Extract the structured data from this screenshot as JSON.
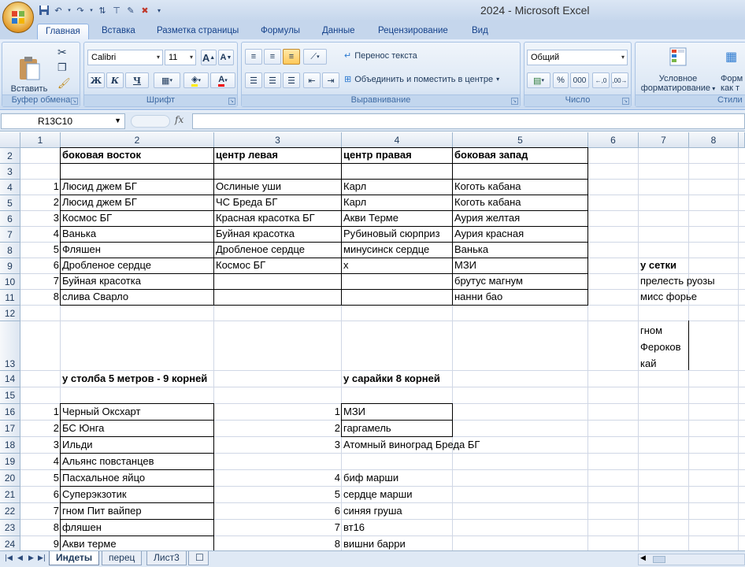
{
  "window": {
    "title": "2024 - Microsoft Excel"
  },
  "tabs": [
    "Главная",
    "Вставка",
    "Разметка страницы",
    "Формулы",
    "Данные",
    "Рецензирование",
    "Вид"
  ],
  "ribbon": {
    "clipboard": {
      "label": "Буфер обмена",
      "paste": "Вставить"
    },
    "font": {
      "label": "Шрифт",
      "name": "Calibri",
      "size": "11",
      "bold": "Ж",
      "italic": "К",
      "underline": "Ч",
      "grow": "A",
      "shrink": "A"
    },
    "alignment": {
      "label": "Выравнивание",
      "wrap": "Перенос текста",
      "merge": "Объединить и поместить в центре"
    },
    "number": {
      "label": "Число",
      "format": "Общий",
      "percent": "%",
      "thousands": "000"
    },
    "styles": {
      "label": "Стили",
      "conditional": "Условное",
      "conditional2": "форматирование",
      "format_as": "Форм",
      "format_as2": "как т"
    }
  },
  "formula_bar": {
    "name_box": "R13C10",
    "fx": "fx",
    "value": ""
  },
  "columns": [
    "1",
    "2",
    "3",
    "4",
    "5",
    "6",
    "7",
    "8"
  ],
  "rows": [
    "2",
    "3",
    "4",
    "5",
    "6",
    "7",
    "8",
    "9",
    "10",
    "11",
    "12",
    "13",
    "14",
    "15",
    "16",
    "17",
    "18",
    "19",
    "20",
    "21",
    "22",
    "23",
    "24"
  ],
  "cells": {
    "r2c2": "боковая восток",
    "r2c3": "центр левая",
    "r2c4": "центр правая",
    "r2c5": "боковая запад",
    "r4c1": "1",
    "r4c2": "Люсид джем БГ",
    "r4c3": "Ослиные уши",
    "r4c4": "Карл",
    "r4c5": "Коготь кабана",
    "r5c1": "2",
    "r5c2": "Люсид джем БГ",
    "r5c3": "ЧС Бреда БГ",
    "r5c4": "Карл",
    "r5c5": "Коготь кабана",
    "r6c1": "3",
    "r6c2": "Космос БГ",
    "r6c3": "Красная красотка БГ",
    "r6c4": "Акви Терме",
    "r6c5": "Аурия желтая",
    "r7c1": "4",
    "r7c2": "Ванька",
    "r7c3": "Буйная красотка",
    "r7c4": "Рубиновый сюрприз",
    "r7c5": "Аурия красная",
    "r8c1": "5",
    "r8c2": "Фляшен",
    "r8c3": "Дробленое сердце",
    "r8c4": "минусинск сердце",
    "r8c5": "Ванька",
    "r9c1": "6",
    "r9c2": "Дробленое сердце",
    "r9c3": "Космос БГ",
    "r9c4": "х",
    "r9c5": "МЗИ",
    "r9c7": "у сетки",
    "r10c1": "7",
    "r10c2": "Буйная красотка",
    "r10c5": "брутус магнум",
    "r10c7": "прелесть руозы",
    "r11c1": "8",
    "r11c2": "слива Сварло",
    "r11c5": "нанни бао",
    "r11c7": "мисс форье",
    "r13c7a": "гном",
    "r13c7b": "Фероков",
    "r13c7c": "кай",
    "r14c2": "у столба 5 метров - 9 корней",
    "r14c4": "у сарайки 8 корней",
    "r16c1": "1",
    "r16c2": "Черный Оксхарт",
    "r16c3": "1",
    "r16c4": "МЗИ",
    "r17c1": "2",
    "r17c2": "БС Юнга",
    "r17c3": "2",
    "r17c4": "гаргамель",
    "r18c1": "3",
    "r18c2": "Ильди",
    "r18c3": "3",
    "r18c4": "Атомный виноград Бреда БГ",
    "r19c1": "4",
    "r19c2": "Альянс повстанцев",
    "r20c1": "5",
    "r20c2": "Пасхальное яйцо",
    "r20c3": "4",
    "r20c4": "биф марши",
    "r21c1": "6",
    "r21c2": "Суперэкзотик",
    "r21c3": "5",
    "r21c4": "сердце марши",
    "r22c1": "7",
    "r22c2": "гном Пит вайпер",
    "r22c3": "6",
    "r22c4": "синяя груша",
    "r23c1": "8",
    "r23c2": "фляшен",
    "r23c3": "7",
    "r23c4": "вт16",
    "r24c1": "9",
    "r24c2": "Акви терме",
    "r24c3": "8",
    "r24c4": "вишни барри"
  },
  "sheets": [
    "Индеты",
    "перец",
    "Лист3"
  ],
  "active_sheet": "Индеты"
}
